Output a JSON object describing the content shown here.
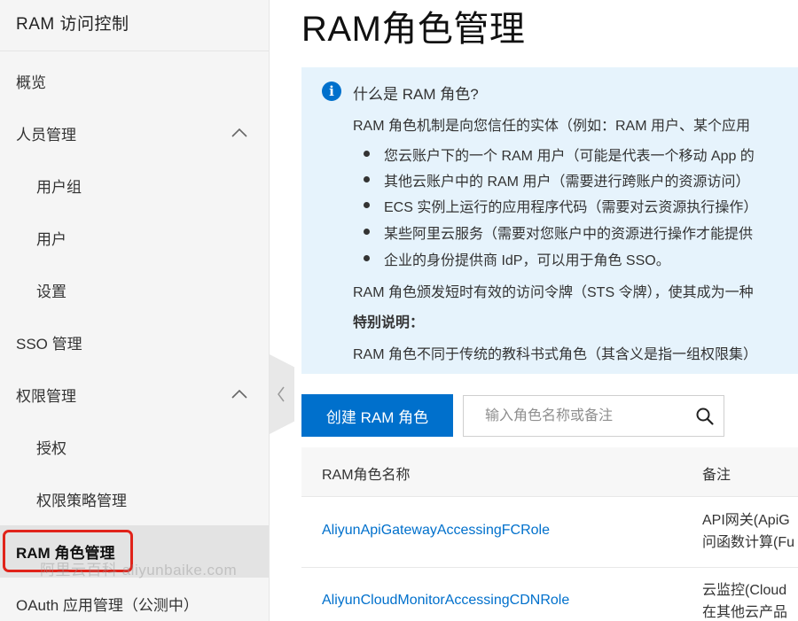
{
  "sidebar": {
    "title": "RAM 访问控制",
    "items": [
      {
        "label": "概览"
      },
      {
        "label": "人员管理"
      },
      {
        "label": "用户组"
      },
      {
        "label": "用户"
      },
      {
        "label": "设置"
      },
      {
        "label": "SSO 管理"
      },
      {
        "label": "权限管理"
      },
      {
        "label": "授权"
      },
      {
        "label": "权限策略管理"
      },
      {
        "label": "RAM 角色管理"
      },
      {
        "label": "OAuth 应用管理（公测中）"
      }
    ],
    "watermark": "阿里云百科 aliyunbaike.com"
  },
  "page": {
    "title": "RAM角色管理"
  },
  "info": {
    "heading": "什么是 RAM 角色?",
    "intro": "RAM 角色机制是向您信任的实体（例如：RAM 用户、某个应用",
    "bullets": [
      "您云账户下的一个 RAM 用户（可能是代表一个移动 App 的",
      "其他云账户中的 RAM 用户（需要进行跨账户的资源访问）",
      "ECS 实例上运行的应用程序代码（需要对云资源执行操作）",
      "某些阿里云服务（需要对您账户中的资源进行操作才能提供",
      "企业的身份提供商 IdP，可以用于角色 SSO。"
    ],
    "token_line": "RAM 角色颁发短时有效的访问令牌（STS 令牌），使其成为一种",
    "special_title": "特别说明：",
    "special_text": "RAM 角色不同于传统的教科书式角色（其含义是指一组权限集）"
  },
  "toolbar": {
    "create_label": "创建 RAM 角色",
    "search_placeholder": "输入角色名称或备注"
  },
  "table": {
    "headers": [
      "RAM角色名称",
      "备注"
    ],
    "rows": [
      {
        "name": "AliyunApiGatewayAccessingFCRole",
        "note_line1": "API网关(ApiG",
        "note_line2": "问函数计算(Fu"
      },
      {
        "name": "AliyunCloudMonitorAccessingCDNRole",
        "note_line1": "云监控(Cloud",
        "note_line2": "在其他云产品"
      }
    ]
  },
  "colors": {
    "accent": "#0070cc",
    "info_bg": "#e6f3fc",
    "highlight": "#e0231a"
  }
}
